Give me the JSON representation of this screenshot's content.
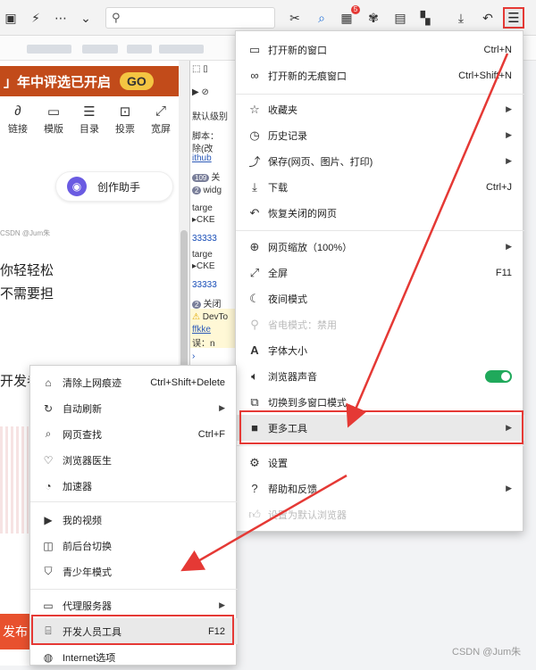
{
  "toolbar": {
    "menu_glyph": "☰",
    "badge": "5"
  },
  "page": {
    "banner_text": "」年中评选已开启",
    "banner_go": "GO",
    "tools": [
      {
        "icon": "link-icon",
        "label": "链接"
      },
      {
        "icon": "template-icon",
        "label": "模版"
      },
      {
        "icon": "toc-icon",
        "label": "目录"
      },
      {
        "icon": "vote-icon",
        "label": "投票"
      },
      {
        "icon": "widescreen-icon",
        "label": "宽屏"
      }
    ],
    "assistant_label": "创作助手",
    "watermark": "CSDN @Jum朱",
    "text_line1": "你轻轻松",
    "text_line2": "不需要担",
    "text_line3": "开发者",
    "publish_label": "发布"
  },
  "devtools": {
    "default_level": "默认级别",
    "line_script": "脚本：",
    "line_remove": "除(改",
    "line_link": "ithub",
    "badge_109": "109",
    "close_label": "关",
    "badge_2a": "2",
    "widget_label": "widg",
    "target1": "targe",
    "cke1": "▸CKE",
    "num1": "33333",
    "target2": "targe",
    "cke2": "▸CKE",
    "num2": "33333",
    "badge_2b": "2",
    "close2": "关闭",
    "warn1": "DevTo",
    "warn2": "ffkke",
    "warn3": "误：n"
  },
  "menu": {
    "items": [
      {
        "icon": "window-icon",
        "label": "打开新的窗口",
        "shortcut": "Ctrl+N"
      },
      {
        "icon": "incognito-icon",
        "label": "打开新的无痕窗口",
        "shortcut": "Ctrl+Shift+N"
      },
      {
        "icon": "star-list-icon",
        "label": "收藏夹",
        "arrow": "▶"
      },
      {
        "icon": "history-icon",
        "label": "历史记录",
        "arrow": "▶"
      },
      {
        "icon": "save-icon",
        "label": "保存(网页、图片、打印)",
        "arrow": "▶"
      },
      {
        "icon": "download-icon",
        "label": "下载",
        "shortcut": "Ctrl+J"
      },
      {
        "icon": "restore-icon",
        "label": "恢复关闭的网页"
      },
      {
        "icon": "zoom-icon",
        "label": "网页缩放（100%）",
        "arrow": "▶"
      },
      {
        "icon": "fullscreen-icon",
        "label": "全屏",
        "shortcut": "F11"
      },
      {
        "icon": "moon-icon",
        "label": "夜间模式"
      },
      {
        "icon": "power-save-icon",
        "label": "省电模式：禁用"
      },
      {
        "icon": "font-size-icon",
        "label": "字体大小"
      },
      {
        "icon": "speaker-icon",
        "label": "浏览器声音"
      },
      {
        "icon": "multi-window-icon",
        "label": "切换到多窗口模式"
      },
      {
        "icon": "toolbox-icon",
        "label": "更多工具",
        "arrow": "▶"
      },
      {
        "icon": "gear-icon",
        "label": "设置"
      },
      {
        "icon": "help-icon",
        "label": "帮助和反馈",
        "arrow": "▶"
      },
      {
        "icon": "thumb-icon",
        "label": "设置为默认浏览器"
      }
    ]
  },
  "submenu": {
    "items": [
      {
        "icon": "broom-icon",
        "label": "清除上网痕迹",
        "shortcut": "Ctrl+Shift+Delete"
      },
      {
        "icon": "refresh-icon",
        "label": "自动刷新",
        "arrow": "▶"
      },
      {
        "icon": "find-icon",
        "label": "网页查找",
        "shortcut": "Ctrl+F"
      },
      {
        "icon": "doctor-icon",
        "label": "浏览器医生"
      },
      {
        "icon": "speedometer-icon",
        "label": "加速器"
      },
      {
        "icon": "video-icon",
        "label": "我的视频"
      },
      {
        "icon": "switch-icon",
        "label": "前后台切换"
      },
      {
        "icon": "shield-icon",
        "label": "青少年模式"
      },
      {
        "icon": "proxy-icon",
        "label": "代理服务器",
        "arrow": "▶"
      },
      {
        "icon": "code-icon",
        "label": "开发人员工具",
        "shortcut": "F12"
      },
      {
        "icon": "globe-icon",
        "label": "Internet选项"
      }
    ]
  },
  "footer": {
    "watermark": "CSDN @Jum朱"
  },
  "colors": {
    "highlight": "#e53935",
    "toggle_on": "#20a95b"
  }
}
